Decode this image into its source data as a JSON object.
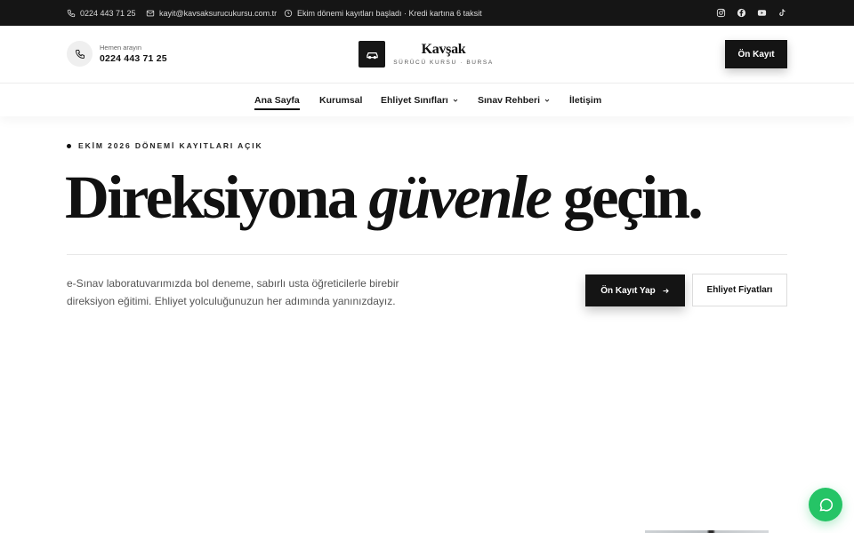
{
  "topbar": {
    "phone": "0224 443 71 25",
    "email": "kayit@kavsaksurucukursu.com.tr",
    "notice": "Ekim dönemi kayıtları başladı · Kredi kartına 6 taksit",
    "socials": [
      "instagram-icon",
      "facebook-icon",
      "youtube-icon",
      "tiktok-icon"
    ]
  },
  "header": {
    "call_label": "Hemen arayın",
    "call_number": "0224 443 71 25",
    "logo_name": "Kavşak",
    "logo_sub": "SÜRÜCÜ KURSU · BURSA",
    "cta_label": "Ön Kayıt"
  },
  "nav": {
    "items": [
      {
        "label": "Ana Sayfa",
        "active": true,
        "dropdown": false
      },
      {
        "label": "Kurumsal",
        "active": false,
        "dropdown": false
      },
      {
        "label": "Ehliyet Sınıfları",
        "active": false,
        "dropdown": true
      },
      {
        "label": "Sınav Rehberi",
        "active": false,
        "dropdown": true
      },
      {
        "label": "İletişim",
        "active": false,
        "dropdown": false
      }
    ]
  },
  "hero": {
    "eyebrow": "EKİM 2026 DÖNEMİ KAYITLARI AÇIK",
    "headline_part1": "Direksiyona",
    "headline_em": "güvenle",
    "headline_part2": "geçin.",
    "lead": "e-Sınav laboratuvarımızda bol deneme, sabırlı usta öğreticilerle birebir direksiyon eğitimi. Ehliyet yolculuğunuzun her adımında yanınızdayız.",
    "primary_cta": "Ön Kayıt Yap",
    "secondary_cta": "Ehliyet Fiyatları"
  },
  "colors": {
    "dark": "#141414",
    "whatsapp": "#25c466",
    "text_muted": "#555555"
  }
}
